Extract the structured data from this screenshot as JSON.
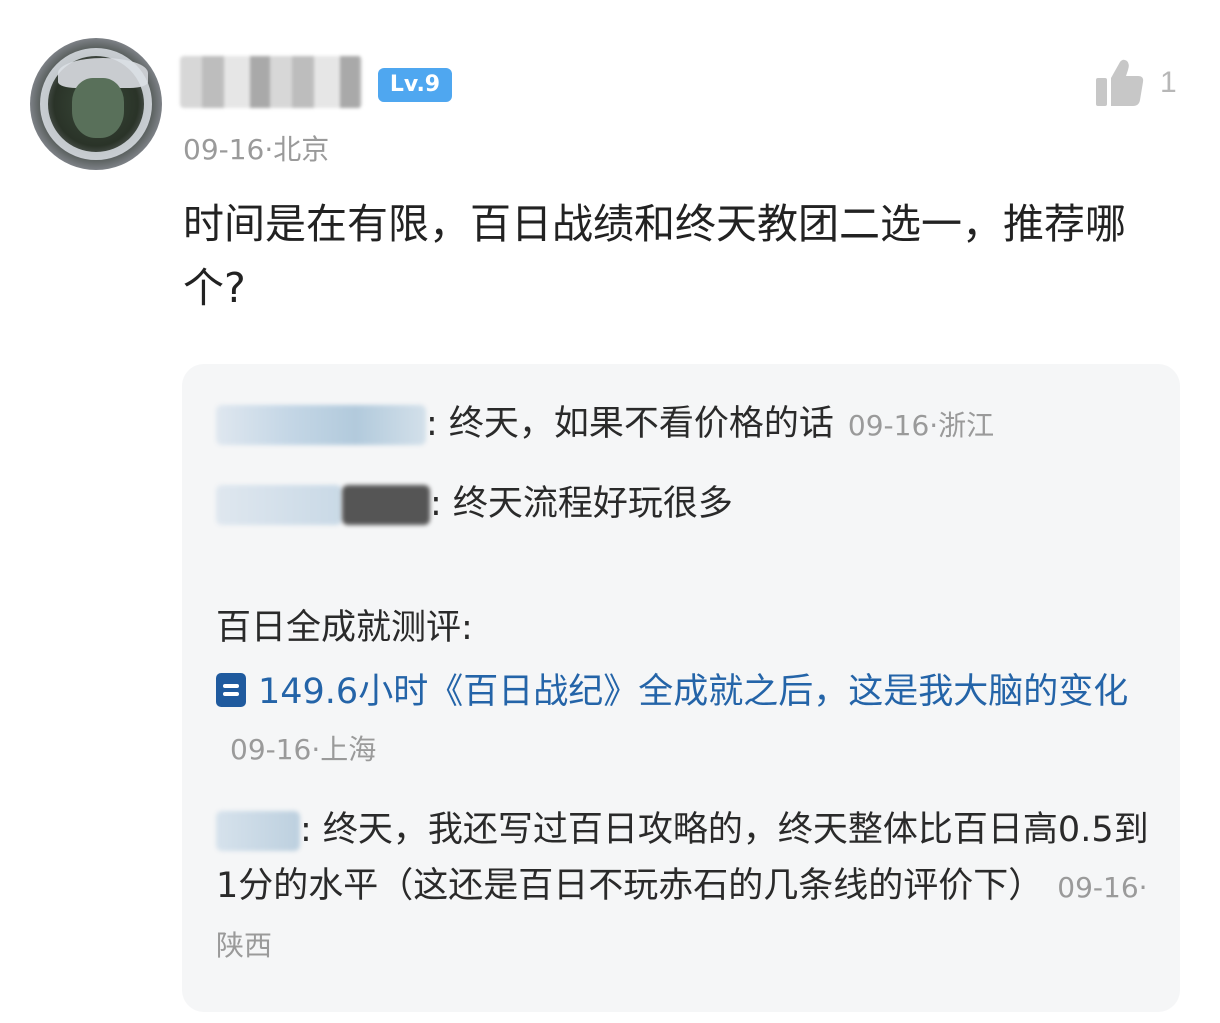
{
  "post": {
    "level": "Lv.9",
    "meta": "09-16·北京",
    "likes": "1",
    "text": "时间是在有限，百日战绩和终天教团二选一，推荐哪个?"
  },
  "replies": [
    {
      "text": ":  终天，如果不看价格的话",
      "time": "09-16·浙江"
    },
    {
      "text": ":  终天流程好玩很多"
    },
    {
      "heading": "百日全成就测评:"
    },
    {
      "link": "149.6小时《百日战纪》全成就之后，这是我大脑的变化",
      "time": "09-16·上海"
    },
    {
      "text": ":  终天，我还写过百日攻略的，终天整体比百日高0.5到1分的水平（这还是百日不玩赤石的几条线的评价下）",
      "time": "09-16·陕西"
    }
  ],
  "icons": {
    "like": "thumbs-up-icon",
    "doc": "document-icon"
  },
  "colors": {
    "badge": "#4fa7f0",
    "link": "#2464a8",
    "meta": "#9a9a9a"
  }
}
